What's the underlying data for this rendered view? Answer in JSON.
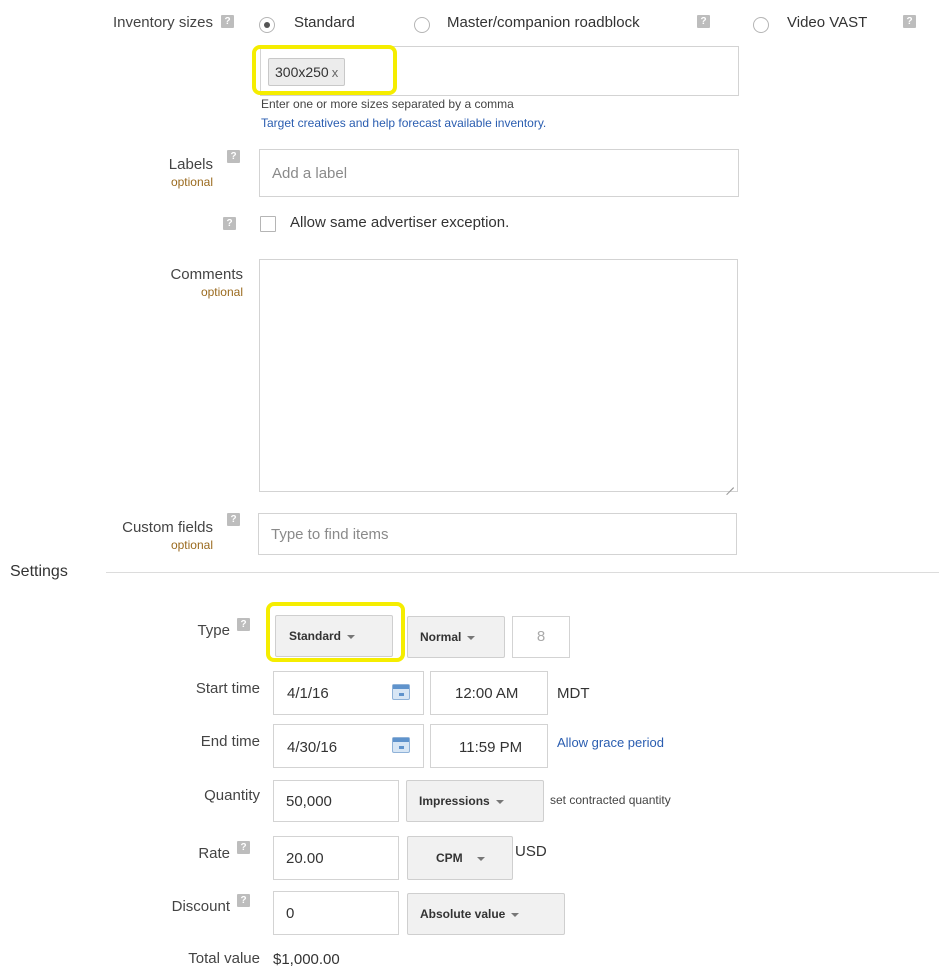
{
  "inventory": {
    "label": "Inventory sizes",
    "options": [
      "Standard",
      "Master/companion roadblock",
      "Video VAST"
    ],
    "selected": "Standard",
    "chip": "300x250",
    "chip_remove": "x",
    "hint": "Enter one or more sizes separated by a comma",
    "link": "Target creatives and help forecast available inventory."
  },
  "labels": {
    "label": "Labels",
    "optional": "optional",
    "placeholder": "Add a label"
  },
  "exception": {
    "text": "Allow same advertiser exception."
  },
  "comments": {
    "label": "Comments",
    "optional": "optional"
  },
  "custom_fields": {
    "label": "Custom fields",
    "optional": "optional",
    "placeholder": "Type to find items"
  },
  "settings": {
    "title": "Settings",
    "type": {
      "label": "Type",
      "value": "Standard",
      "priority": "Normal",
      "priority_number": "8"
    },
    "start": {
      "label": "Start time",
      "date": "4/1/16",
      "time": "12:00 AM",
      "tz": "MDT"
    },
    "end": {
      "label": "End time",
      "date": "4/30/16",
      "time": "11:59 PM",
      "link": "Allow grace period"
    },
    "quantity": {
      "label": "Quantity",
      "value": "50,000",
      "unit": "Impressions",
      "note": "set contracted quantity"
    },
    "rate": {
      "label": "Rate",
      "value": "20.00",
      "model": "CPM",
      "currency": "USD"
    },
    "discount": {
      "label": "Discount",
      "value": "0",
      "kind": "Absolute value"
    },
    "total": {
      "label": "Total value",
      "value": "$1,000.00"
    }
  },
  "colors": {
    "highlight": "#f5ed00",
    "link": "#2a5db0",
    "optional": "#9a6a1e"
  }
}
